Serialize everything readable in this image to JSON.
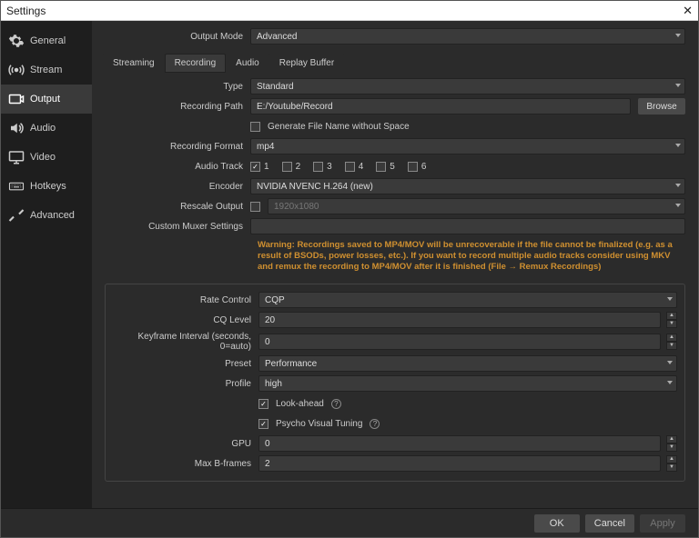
{
  "window": {
    "title": "Settings",
    "close_glyph": "✕"
  },
  "sidebar": {
    "items": [
      {
        "label": "General"
      },
      {
        "label": "Stream"
      },
      {
        "label": "Output"
      },
      {
        "label": "Audio"
      },
      {
        "label": "Video"
      },
      {
        "label": "Hotkeys"
      },
      {
        "label": "Advanced"
      }
    ]
  },
  "output_mode": {
    "label": "Output Mode",
    "value": "Advanced"
  },
  "tabs": {
    "streaming": "Streaming",
    "recording": "Recording",
    "audio": "Audio",
    "replay": "Replay Buffer"
  },
  "fields": {
    "type": {
      "label": "Type",
      "value": "Standard"
    },
    "recording_path": {
      "label": "Recording Path",
      "value": "E:/Youtube/Record",
      "browse": "Browse"
    },
    "gen_filename": {
      "label": "Generate File Name without Space",
      "checked": false
    },
    "recording_format": {
      "label": "Recording Format",
      "value": "mp4"
    },
    "audio_track": {
      "label": "Audio Track",
      "tracks": [
        {
          "n": "1",
          "checked": true
        },
        {
          "n": "2",
          "checked": false
        },
        {
          "n": "3",
          "checked": false
        },
        {
          "n": "4",
          "checked": false
        },
        {
          "n": "5",
          "checked": false
        },
        {
          "n": "6",
          "checked": false
        }
      ]
    },
    "encoder": {
      "label": "Encoder",
      "value": "NVIDIA NVENC H.264 (new)"
    },
    "rescale_output": {
      "label": "Rescale Output",
      "checked": false,
      "value": "1920x1080"
    },
    "custom_muxer": {
      "label": "Custom Muxer Settings",
      "value": ""
    }
  },
  "warning_text": "Warning: Recordings saved to MP4/MOV will be unrecoverable if the file cannot be finalized (e.g. as a result of BSODs, power losses, etc.). If you want to record multiple audio tracks consider using MKV and remux the recording to MP4/MOV after it is finished (File → Remux Recordings)",
  "encoder_settings": {
    "rate_control": {
      "label": "Rate Control",
      "value": "CQP"
    },
    "cq_level": {
      "label": "CQ Level",
      "value": "20"
    },
    "keyframe": {
      "label": "Keyframe Interval (seconds, 0=auto)",
      "value": "0"
    },
    "preset": {
      "label": "Preset",
      "value": "Performance"
    },
    "profile": {
      "label": "Profile",
      "value": "high"
    },
    "lookahead": {
      "label": "Look-ahead",
      "checked": true
    },
    "psycho": {
      "label": "Psycho Visual Tuning",
      "checked": true
    },
    "gpu": {
      "label": "GPU",
      "value": "0"
    },
    "max_b": {
      "label": "Max B-frames",
      "value": "2"
    }
  },
  "footer": {
    "ok": "OK",
    "cancel": "Cancel",
    "apply": "Apply"
  }
}
